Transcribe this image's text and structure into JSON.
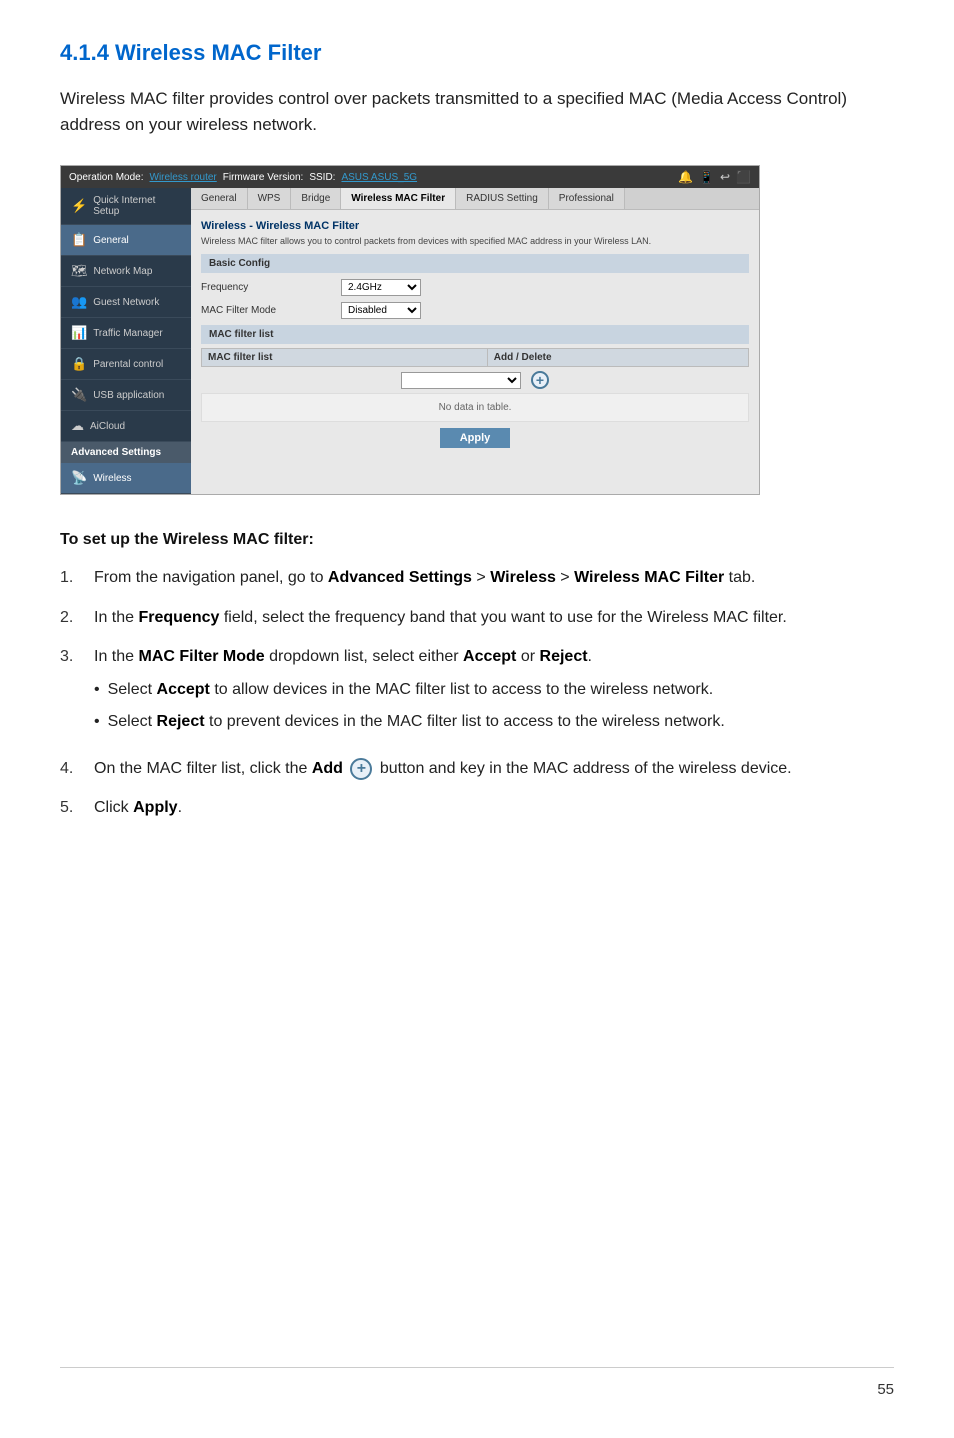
{
  "page": {
    "title": "4.1.4 Wireless MAC Filter",
    "intro": "Wireless MAC filter provides control over packets transmitted to a specified MAC (Media Access Control) address on your wireless network.",
    "page_number": "55"
  },
  "router_ui": {
    "topbar": {
      "operation_mode_label": "Operation Mode:",
      "operation_mode_value": "Wireless router",
      "firmware_label": "Firmware Version:",
      "ssid_label": "SSID:",
      "ssid_values": "ASUS  ASUS_5G"
    },
    "tabs": [
      {
        "label": "General",
        "active": false
      },
      {
        "label": "WPS",
        "active": false
      },
      {
        "label": "Bridge",
        "active": false
      },
      {
        "label": "Wireless MAC Filter",
        "active": true
      },
      {
        "label": "RADIUS Setting",
        "active": false
      },
      {
        "label": "Professional",
        "active": false
      }
    ],
    "sidebar": {
      "items": [
        {
          "label": "Quick Internet Setup",
          "icon": "⚡",
          "active": false
        },
        {
          "label": "General",
          "icon": "📋",
          "active": false
        },
        {
          "label": "Network Map",
          "icon": "🗺",
          "active": false
        },
        {
          "label": "Guest Network",
          "icon": "👥",
          "active": false
        },
        {
          "label": "Traffic Manager",
          "icon": "📊",
          "active": false
        },
        {
          "label": "Parental control",
          "icon": "🔒",
          "active": false
        },
        {
          "label": "USB application",
          "icon": "🔌",
          "active": false
        },
        {
          "label": "AiCloud",
          "icon": "☁",
          "active": false
        }
      ],
      "section_label": "Advanced Settings",
      "active_subsection": "Wireless"
    },
    "content": {
      "section_title": "Wireless - Wireless MAC Filter",
      "section_desc": "Wireless MAC filter allows you to control packets from devices with specified MAC address in your Wireless LAN.",
      "basic_config_label": "Basic Config",
      "frequency_label": "Frequency",
      "frequency_value": "2.4GHz",
      "mac_filter_mode_label": "MAC Filter Mode",
      "mac_filter_mode_value": "Disabled",
      "mac_filter_list_label": "MAC filter list",
      "mac_filter_list_col": "MAC filter list",
      "add_delete_label": "Add / Delete",
      "no_data_text": "No data in table.",
      "apply_button": "Apply"
    }
  },
  "instructions": {
    "title": "To set up the Wireless MAC filter:",
    "steps": [
      {
        "num": "1.",
        "text_parts": [
          "From the navigation panel, go to ",
          "Advanced Settings",
          " > ",
          "Wireless",
          " > ",
          "Wireless MAC Filter",
          " tab."
        ],
        "bold_indices": [
          1,
          3,
          5
        ]
      },
      {
        "num": "2.",
        "text_parts": [
          "In the ",
          "Frequency",
          " field, select the frequency band that you want to use for the Wireless MAC filter."
        ],
        "bold_indices": [
          1
        ]
      },
      {
        "num": "3.",
        "text_parts": [
          "In the ",
          "MAC Filter Mode",
          " dropdown list, select either ",
          "Accept",
          " or ",
          "Reject",
          "."
        ],
        "bold_indices": [
          1,
          3,
          5
        ],
        "sub_items": [
          {
            "text_parts": [
              "Select ",
              "Accept",
              " to allow devices in the MAC filter list to access to the wireless network."
            ],
            "bold_indices": [
              1
            ]
          },
          {
            "text_parts": [
              "Select ",
              "Reject",
              " to prevent devices in the MAC filter list to access to the wireless network."
            ],
            "bold_indices": [
              1
            ]
          }
        ]
      },
      {
        "num": "4.",
        "text_parts": [
          "On the MAC filter list, click the ",
          "Add",
          "  button and key in the MAC address of the wireless device."
        ],
        "bold_indices": [
          1
        ],
        "has_add_icon": true
      },
      {
        "num": "5.",
        "text_parts": [
          "Click ",
          "Apply",
          "."
        ],
        "bold_indices": [
          1
        ]
      }
    ]
  }
}
